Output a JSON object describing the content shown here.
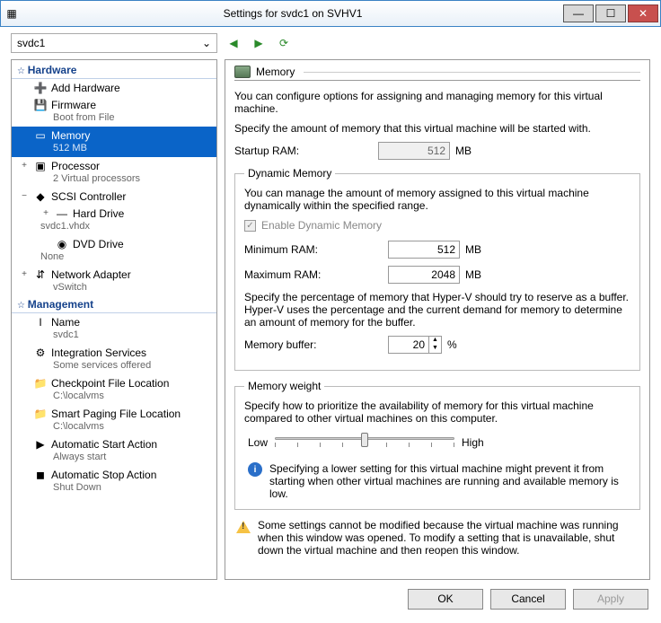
{
  "window": {
    "title": "Settings for svdc1 on SVHV1"
  },
  "toolbar": {
    "vm_name": "svdc1"
  },
  "tree": {
    "hardware_label": "Hardware",
    "management_label": "Management",
    "hw": [
      {
        "icon": "➕",
        "label": "Add Hardware",
        "sub": ""
      },
      {
        "icon": "💾",
        "label": "Firmware",
        "sub": "Boot from File"
      },
      {
        "icon": "▭",
        "label": "Memory",
        "sub": "512 MB",
        "selected": true
      },
      {
        "icon": "▣",
        "label": "Processor",
        "sub": "2 Virtual processors",
        "exp": "+"
      },
      {
        "icon": "◆",
        "label": "SCSI Controller",
        "sub": "",
        "exp": "−"
      },
      {
        "icon": "—",
        "label": "Hard Drive",
        "sub": "svdc1.vhdx",
        "indent": true,
        "exp": "+"
      },
      {
        "icon": "◉",
        "label": "DVD Drive",
        "sub": "None",
        "indent": true
      },
      {
        "icon": "⇵",
        "label": "Network Adapter",
        "sub": "vSwitch",
        "exp": "+"
      }
    ],
    "mg": [
      {
        "icon": "I",
        "label": "Name",
        "sub": "svdc1"
      },
      {
        "icon": "⚙",
        "label": "Integration Services",
        "sub": "Some services offered"
      },
      {
        "icon": "📁",
        "label": "Checkpoint File Location",
        "sub": "C:\\localvms"
      },
      {
        "icon": "📁",
        "label": "Smart Paging File Location",
        "sub": "C:\\localvms"
      },
      {
        "icon": "▶",
        "label": "Automatic Start Action",
        "sub": "Always start"
      },
      {
        "icon": "◼",
        "label": "Automatic Stop Action",
        "sub": "Shut Down"
      }
    ]
  },
  "panel": {
    "title": "Memory",
    "intro1": "You can configure options for assigning and managing memory for this virtual machine.",
    "intro2": "Specify the amount of memory that this virtual machine will be started with.",
    "startup_label": "Startup RAM:",
    "startup_value": "512",
    "mb": "MB",
    "dyn_legend": "Dynamic Memory",
    "dyn_intro": "You can manage the amount of memory assigned to this virtual machine dynamically within the specified range.",
    "enable_chk": "Enable Dynamic Memory",
    "min_label": "Minimum RAM:",
    "min_value": "512",
    "max_label": "Maximum RAM:",
    "max_value": "2048",
    "buffer_intro": "Specify the percentage of memory that Hyper-V should try to reserve as a buffer. Hyper-V uses the percentage and the current demand for memory to determine an amount of memory for the buffer.",
    "buffer_label": "Memory buffer:",
    "buffer_value": "20",
    "pct": "%",
    "weight_legend": "Memory weight",
    "weight_intro": "Specify how to prioritize the availability of memory for this virtual machine compared to other virtual machines on this computer.",
    "low": "Low",
    "high": "High",
    "weight_info": "Specifying a lower setting for this virtual machine might prevent it from starting when other virtual machines are running and available memory is low.",
    "warn": "Some settings cannot be modified because the virtual machine was running when this window was opened. To modify a setting that is unavailable, shut down the virtual machine and then reopen this window."
  },
  "buttons": {
    "ok": "OK",
    "cancel": "Cancel",
    "apply": "Apply"
  }
}
